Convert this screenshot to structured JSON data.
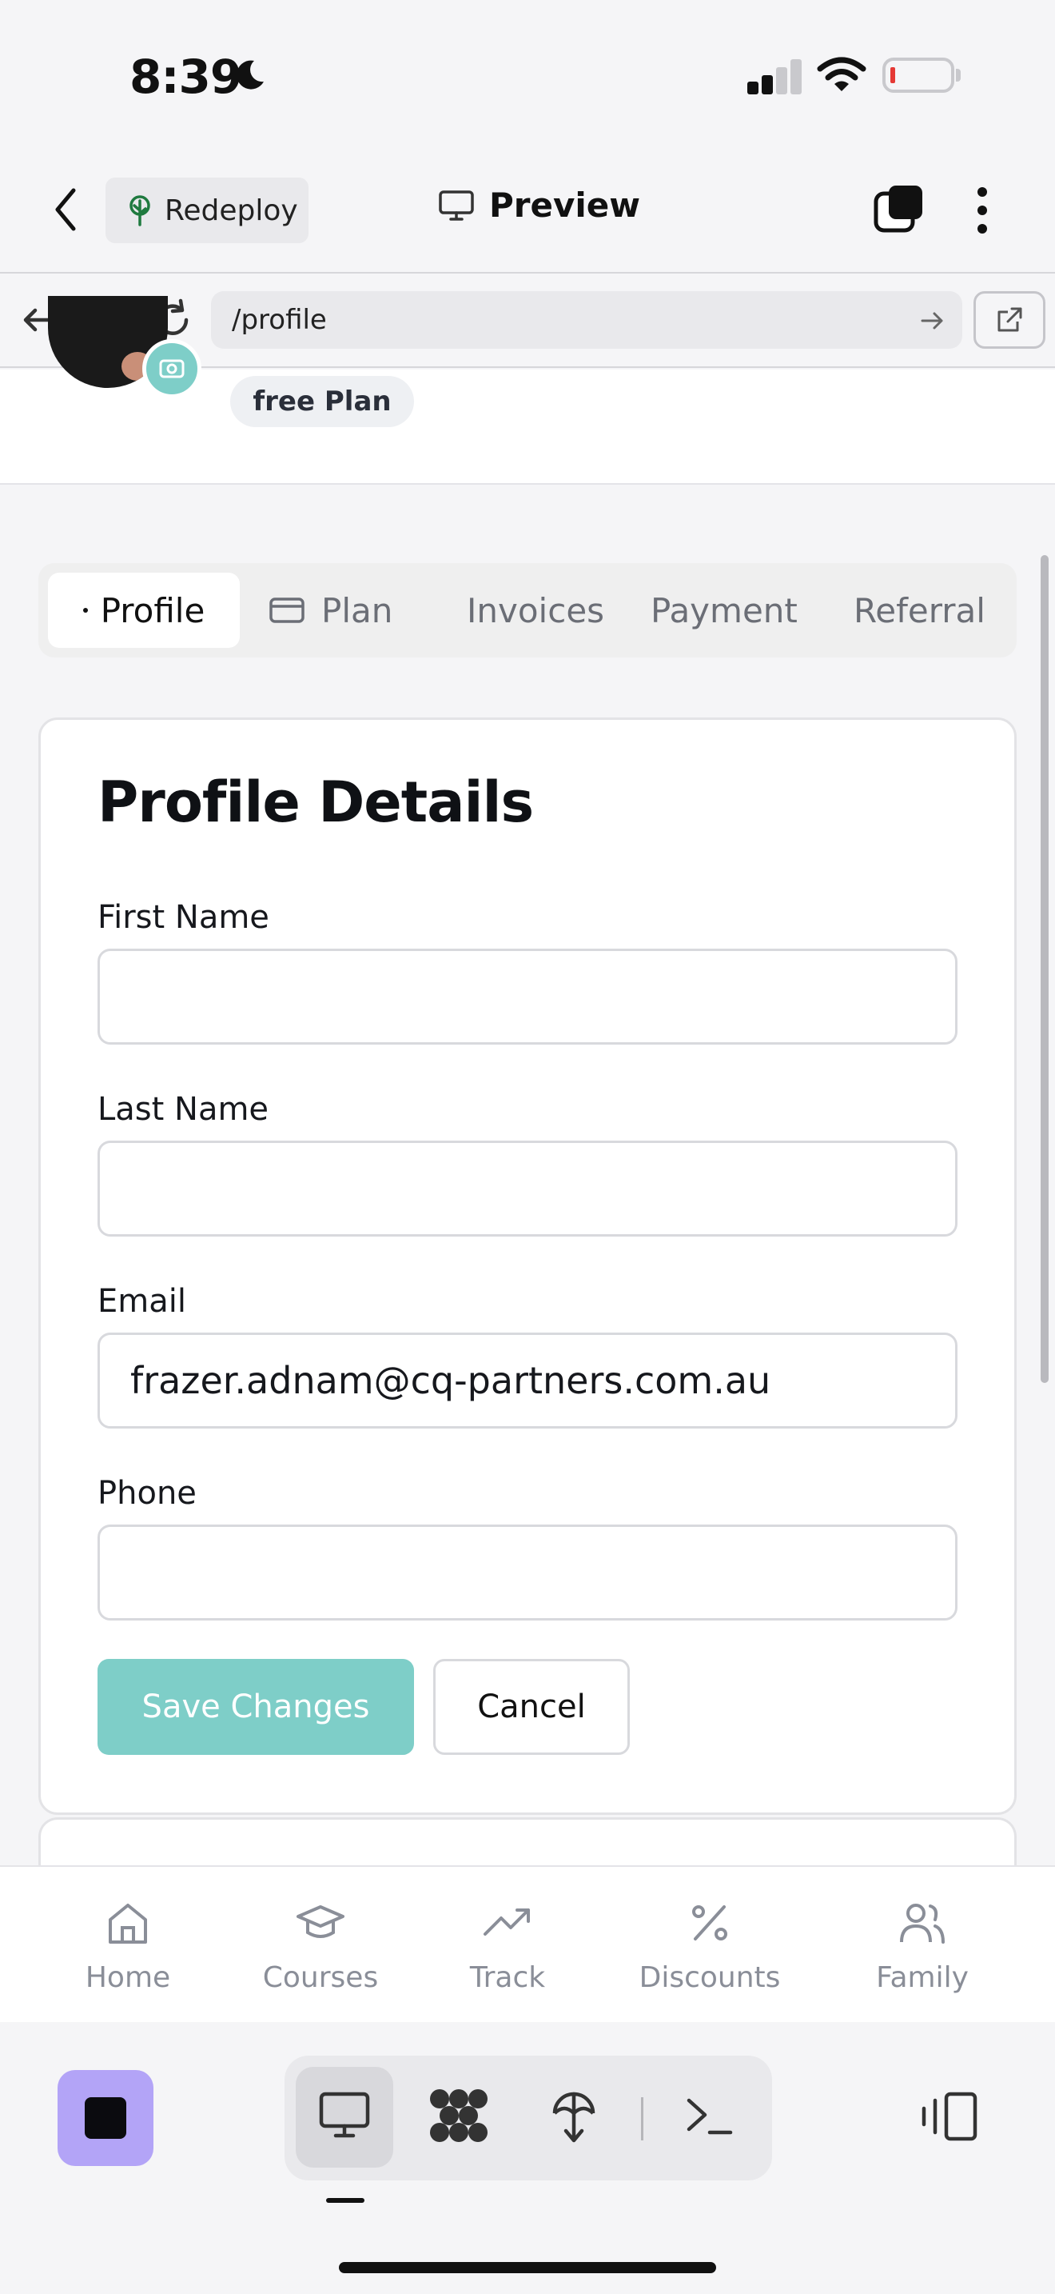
{
  "status_bar": {
    "time": "8:39"
  },
  "top_bar": {
    "redeploy_label": "Redeploy",
    "preview_label": "Preview"
  },
  "browser": {
    "url": "/profile"
  },
  "profile": {
    "plan_badge": "free Plan"
  },
  "tabs": [
    {
      "label": "Profile",
      "active": true
    },
    {
      "label": "Plan",
      "active": false
    },
    {
      "label": "Invoices",
      "active": false
    },
    {
      "label": "Payment",
      "active": false
    },
    {
      "label": "Referral",
      "active": false
    }
  ],
  "form": {
    "title": "Profile Details",
    "first_name": {
      "label": "First Name",
      "value": ""
    },
    "last_name": {
      "label": "Last Name",
      "value": ""
    },
    "email": {
      "label": "Email",
      "value": "frazer.adnam@cq-partners.com.au"
    },
    "phone": {
      "label": "Phone",
      "value": ""
    },
    "save_label": "Save Changes",
    "cancel_label": "Cancel"
  },
  "bottom_nav": [
    {
      "label": "Home",
      "icon": "home-icon"
    },
    {
      "label": "Courses",
      "icon": "graduation-cap-icon"
    },
    {
      "label": "Track",
      "icon": "trending-up-icon"
    },
    {
      "label": "Discounts",
      "icon": "percent-icon"
    },
    {
      "label": "Family",
      "icon": "users-icon"
    }
  ],
  "colors": {
    "accent": "#7ecec8",
    "app_icon": "#b3a4f7",
    "text": "#111111",
    "muted": "#8a8e98"
  }
}
